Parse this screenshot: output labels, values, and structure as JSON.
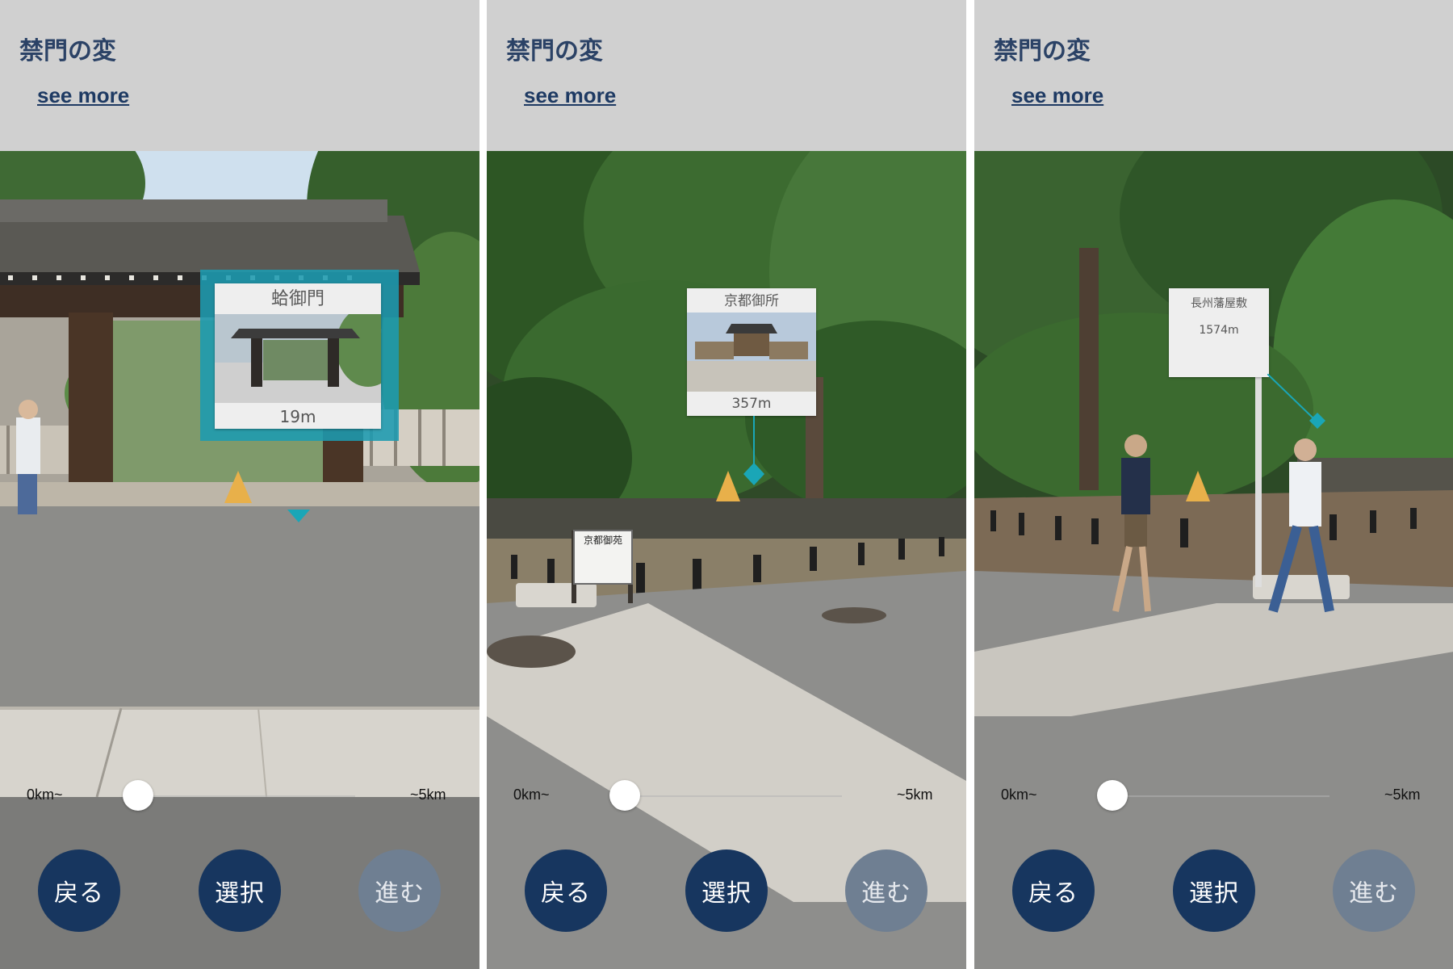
{
  "screens": [
    {
      "title": "禁門の変",
      "see_more": "see more",
      "poi": {
        "name": "蛤御門",
        "distance": "19m"
      },
      "slider": {
        "min_label": "0km~",
        "max_label": "~5km",
        "value": 0
      },
      "buttons": {
        "back": "戻る",
        "select": "選択",
        "next": "進む"
      }
    },
    {
      "title": "禁門の変",
      "see_more": "see more",
      "poi": {
        "name": "京都御所",
        "distance": "357m"
      },
      "sign_text": "京都御苑",
      "slider": {
        "min_label": "0km~",
        "max_label": "~5km",
        "value": 0
      },
      "buttons": {
        "back": "戻る",
        "select": "選択",
        "next": "進む"
      }
    },
    {
      "title": "禁門の変",
      "see_more": "see more",
      "poi": {
        "name": "長州藩屋敷",
        "distance": "1574m"
      },
      "slider": {
        "min_label": "0km~",
        "max_label": "~5km",
        "value": 0
      },
      "buttons": {
        "back": "戻る",
        "select": "選択",
        "next": "進む"
      }
    }
  ],
  "colors": {
    "header_bg": "#d0d0d0",
    "title": "#2b4266",
    "button_active": "#17365f",
    "button_disabled": "#6f7f92",
    "ar_frame": "#1c9bb0",
    "marker_orange": "#e8b04a",
    "marker_teal": "#1aa6b7"
  },
  "icons": {
    "slider_thumb": "circle",
    "direction_marker": "triangle-icon",
    "pin_marker": "diamond-pin-icon"
  }
}
